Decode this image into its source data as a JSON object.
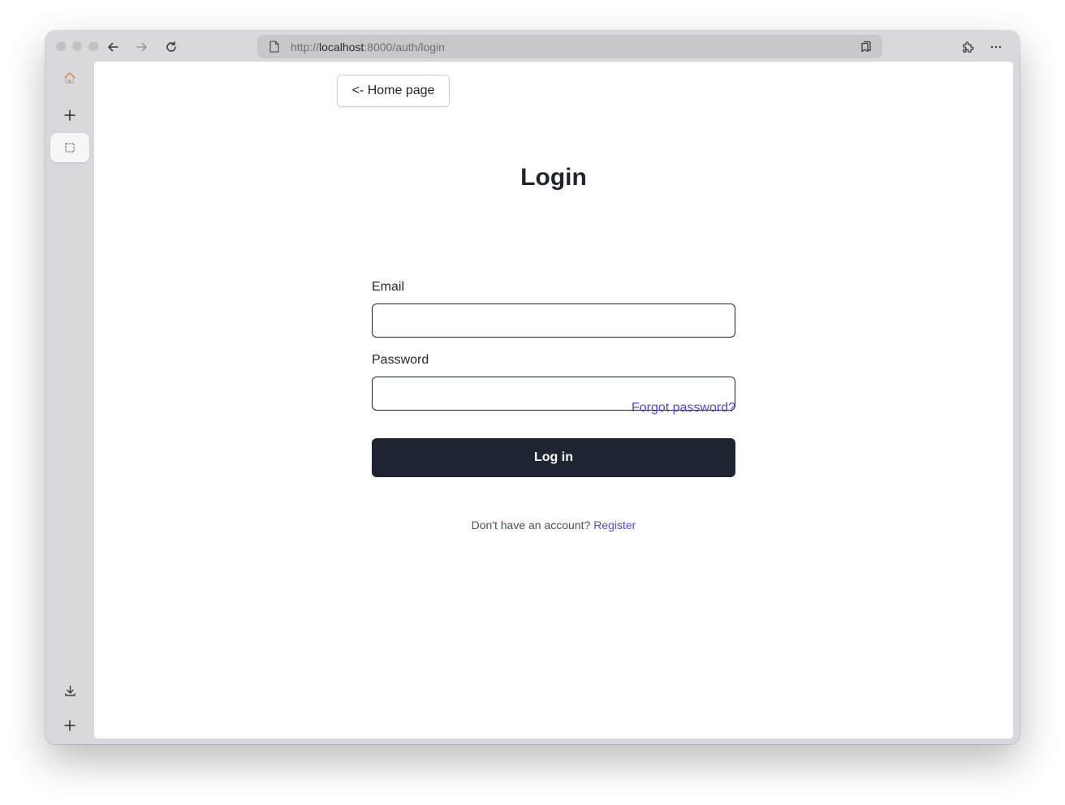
{
  "browser": {
    "url_prefix": "http://",
    "url_host": "localhost",
    "url_path": ":8000/auth/login"
  },
  "page": {
    "home_button": "<- Home page",
    "title": "Login",
    "email_label": "Email",
    "email_value": "",
    "password_label": "Password",
    "password_value": "",
    "forgot_link": "Forgot password?",
    "login_button": "Log in",
    "register_prompt": "Don't have an account?",
    "register_link": "Register"
  },
  "colors": {
    "primary_button": "#1e2431",
    "link": "#4f46e5",
    "text": "#1f2530"
  }
}
